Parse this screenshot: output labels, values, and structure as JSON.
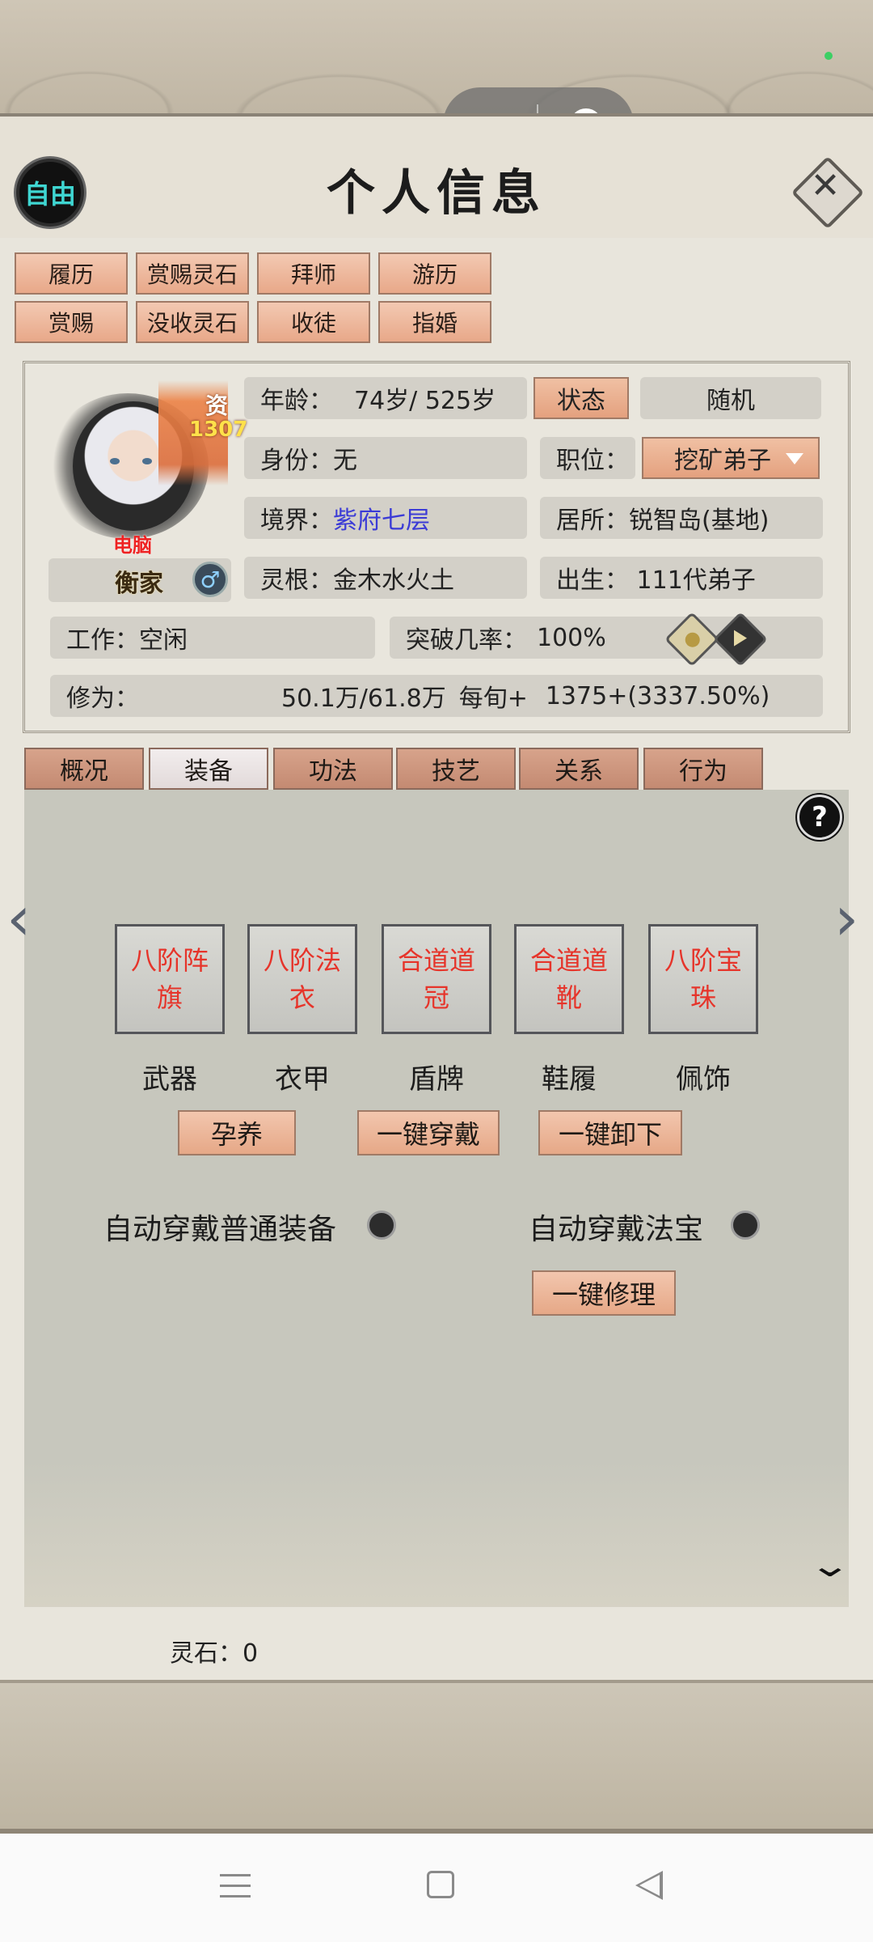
{
  "header": {
    "title": "个人信息",
    "free_button": "自由",
    "close_icon": "close-icon"
  },
  "actions": {
    "row1": [
      "履历",
      "赏赐灵石",
      "拜师",
      "游历"
    ],
    "row2": [
      "赏赐",
      "没收灵石",
      "收徒",
      "指婚"
    ]
  },
  "character": {
    "name": "衡家",
    "gender": "♂",
    "talent_label": "资",
    "talent_value": "1307",
    "tag": "电脑",
    "age_label": "年龄：",
    "age_value": "74岁/ 525岁",
    "state_button": "状态",
    "random_button": "随机",
    "identity_label": "身份：",
    "identity_value": "无",
    "position_label": "职位：",
    "position_value": "挖矿弟子",
    "realm_label": "境界：",
    "realm_value": "紫府七层",
    "residence": "居所：锐智岛(基地)",
    "root_label": "灵根：",
    "root_value": "金木水火土",
    "birth": "出生：  111代弟子",
    "work": "工作：空闲",
    "breakthrough_label": "突破几率：",
    "breakthrough_value": "100%",
    "cultivation_label": "修为：",
    "cultivation_value": "50.1万/61.8万",
    "per_turn_label": "每旬+",
    "per_turn_value": "1375+(3337.50%)"
  },
  "tabs": [
    "概况",
    "装备",
    "功法",
    "技艺",
    "关系",
    "行为"
  ],
  "active_tab": "装备",
  "equipment": {
    "slots": [
      {
        "item": "八阶阵旗",
        "slot": "武器"
      },
      {
        "item": "八阶法衣",
        "slot": "衣甲"
      },
      {
        "item": "合道道冠",
        "slot": "盾牌"
      },
      {
        "item": "合道道靴",
        "slot": "鞋履"
      },
      {
        "item": "八阶宝珠",
        "slot": "佩饰"
      }
    ],
    "buttons": [
      "孕养",
      "一键穿戴",
      "一键卸下"
    ],
    "auto_normal": "自动穿戴普通装备",
    "auto_treasure": "自动穿戴法宝",
    "repair_button": "一键修理",
    "item_color": "#e6342a"
  },
  "footer": {
    "spirit_stone": "灵石：0"
  },
  "colors": {
    "accent_button": "#e8a889",
    "realm_text": "#3b3bd6",
    "free_text": "#3fd6d2"
  }
}
